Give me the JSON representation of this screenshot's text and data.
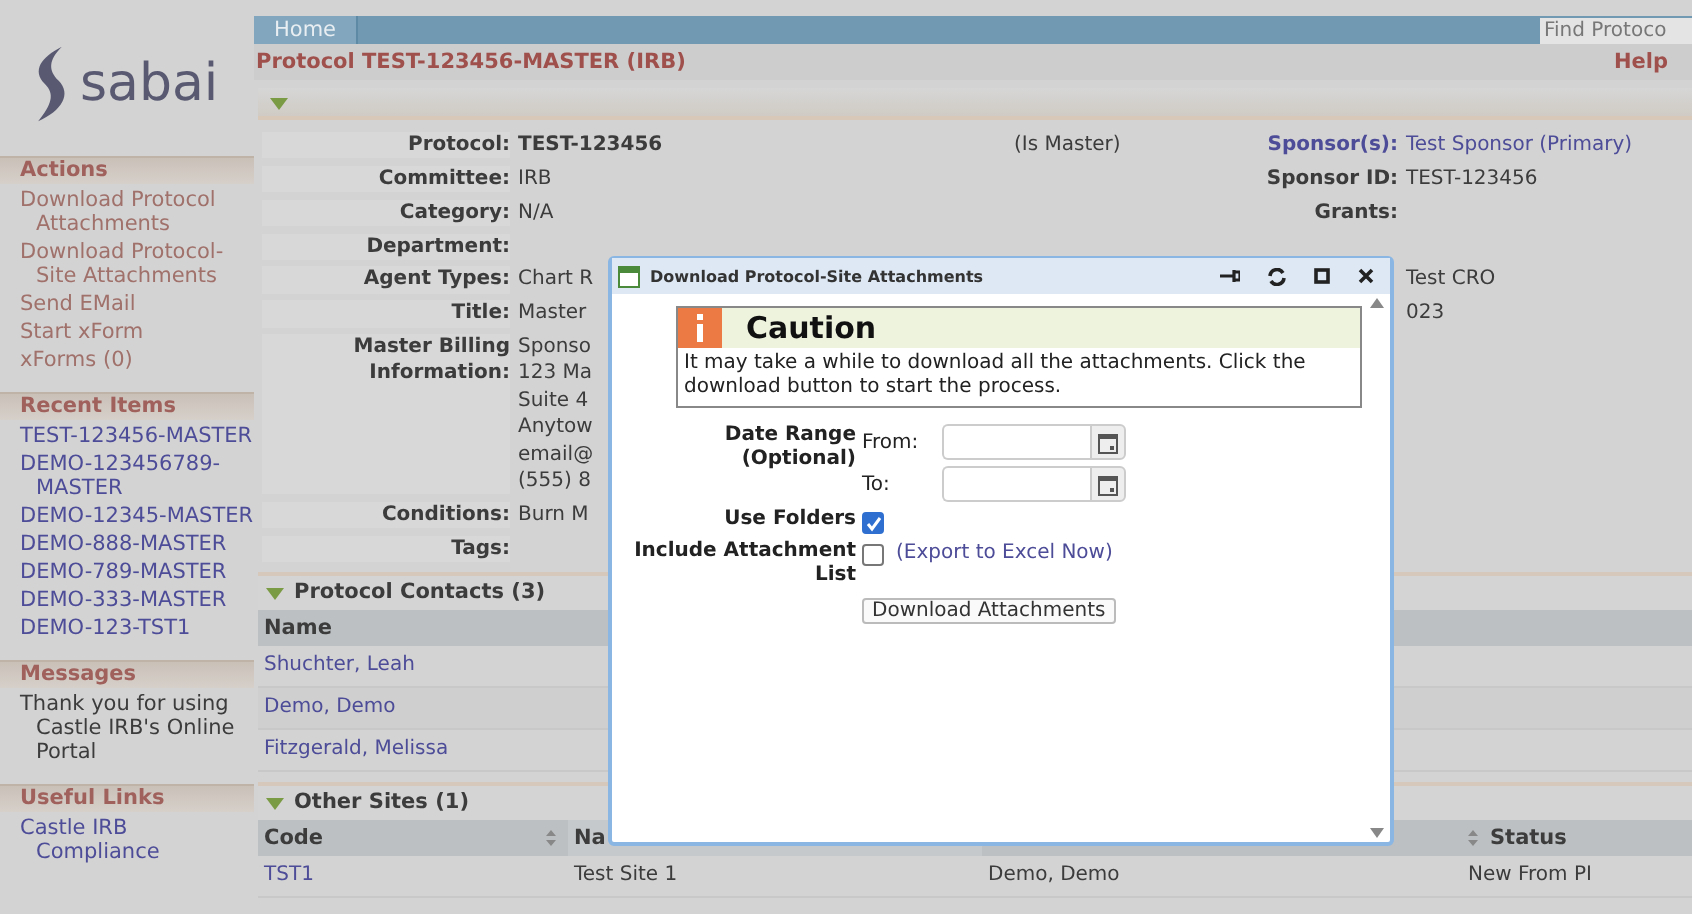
{
  "sidebar": {
    "logo": "sabai",
    "sections": [
      {
        "title": "Actions",
        "kind": "actions",
        "items": [
          "Download Protocol Attachments",
          "Download Protocol-Site Attachments",
          "Send EMail",
          "Start xForm",
          "xForms (0)"
        ]
      },
      {
        "title": "Recent Items",
        "kind": "links",
        "items": [
          "TEST-123456-MASTER",
          "DEMO-123456789-MASTER",
          "DEMO-12345-MASTER",
          "DEMO-888-MASTER",
          "DEMO-789-MASTER",
          "DEMO-333-MASTER",
          "DEMO-123-TST1"
        ]
      },
      {
        "title": "Messages",
        "kind": "message",
        "items": [
          "Thank you for using Castle IRB's Online Portal"
        ]
      },
      {
        "title": "Useful Links",
        "kind": "links",
        "items": [
          "Castle IRB Compliance"
        ]
      }
    ]
  },
  "nav": {
    "tabs": [
      "Home"
    ],
    "search": {
      "placeholder": "Find Protoco"
    }
  },
  "header": {
    "title": "Protocol TEST-123456-MASTER (IRB)",
    "help": "Help"
  },
  "details": [
    {
      "label": "Protocol:",
      "value": [
        "TEST-123456"
      ],
      "kind": "bold",
      "note": "(Is Master)",
      "right": {
        "label": "Sponsor(s):",
        "value": "Test Sponsor (Primary)",
        "kind": "link"
      }
    },
    {
      "label": "Committee:",
      "value": [
        "IRB"
      ],
      "kind": "plain",
      "right": {
        "label": "Sponsor ID:",
        "value": "TEST-123456",
        "kind": "plain"
      }
    },
    {
      "label": "Category:",
      "value": [
        "N/A"
      ],
      "kind": "plain",
      "right": {
        "label": "Grants:"
      }
    },
    {
      "label": "Department:"
    },
    {
      "label": "Agent Types:",
      "value": [
        "Chart R"
      ],
      "kind": "plain",
      "right": {
        "value": "Test CRO",
        "kind": "plain"
      }
    },
    {
      "label": "Title:",
      "value": [
        "Master"
      ],
      "kind": "plain",
      "right": {
        "value": "023",
        "kind": "plain"
      }
    },
    {
      "label": "Master Billing Information:",
      "value": [
        "Sponso",
        "123 Ma",
        "Suite 4",
        "Anytow",
        "email@",
        "(555) 8"
      ],
      "kind": "plain"
    },
    {
      "label": "Conditions:",
      "value": [
        "Burn M"
      ],
      "kind": "plain"
    },
    {
      "label": "Tags:"
    }
  ],
  "contacts": {
    "title": "Protocol Contacts (3)",
    "expanded": true,
    "columns": [
      "Name"
    ],
    "rows": [
      "Shuchter, Leah",
      "Demo, Demo",
      "Fitzgerald, Melissa"
    ]
  },
  "other_sites": {
    "title": "Other Sites (1)",
    "expanded": true,
    "columns": [
      {
        "label": "Code",
        "sortable": true
      },
      {
        "label": "Na",
        "sortable": false
      },
      {},
      {
        "label": "Status",
        "sortable": true
      }
    ],
    "rows": [
      [
        "TST1",
        "Test Site 1",
        "Demo, Demo",
        "New From PI"
      ]
    ]
  },
  "dialog": {
    "title": "Download Protocol-Site Attachments",
    "caution": {
      "title": "Caution",
      "text": "It may take a while to download all the attachments. Click the download button to start the process."
    },
    "date_label": "Date Range (Optional)",
    "from_label": "From:",
    "to_label": "To:",
    "use_folders": {
      "label": "Use Folders",
      "checked": true
    },
    "include_list": {
      "label": "Include Attachment List",
      "checked": false,
      "link": "(Export to Excel Now)"
    },
    "button": "Download Attachments"
  }
}
